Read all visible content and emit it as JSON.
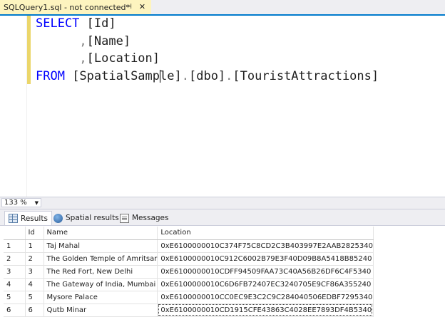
{
  "document_tab": {
    "title": "SQLQuery1.sql - not connected*",
    "pin_icon": "pin-icon",
    "close_icon": "close-icon",
    "background": "#fdf4bf"
  },
  "editor": {
    "lines": [
      [
        {
          "text": "SELECT ",
          "cls": "kw"
        },
        {
          "text": "[Id]",
          "cls": "ident"
        }
      ],
      [
        {
          "text": "      ,",
          "cls": "gray"
        },
        {
          "text": "[Name]",
          "cls": "ident"
        }
      ],
      [
        {
          "text": "      ,",
          "cls": "gray"
        },
        {
          "text": "[Location]",
          "cls": "ident"
        }
      ],
      [
        {
          "text": "FROM ",
          "cls": "kw"
        },
        {
          "text": "[SpatialSamp",
          "cls": "ident"
        },
        {
          "caret": true
        },
        {
          "text": "le]",
          "cls": "ident"
        },
        {
          "text": ".",
          "cls": "gray"
        },
        {
          "text": "[dbo]",
          "cls": "ident"
        },
        {
          "text": ".",
          "cls": "gray"
        },
        {
          "text": "[TouristAttractions]",
          "cls": "ident"
        }
      ]
    ],
    "keyword_color": "#0000ff"
  },
  "zoom": {
    "value": "133 %"
  },
  "results_tabs": [
    {
      "label": "Results",
      "icon": "grid-icon",
      "active": true
    },
    {
      "label": "Spatial results",
      "icon": "globe-icon",
      "active": false
    },
    {
      "label": "Messages",
      "icon": "messages-icon",
      "active": false
    }
  ],
  "results": {
    "columns": [
      "",
      "Id",
      "Name",
      "Location"
    ],
    "rows": [
      [
        "1",
        "1",
        "Taj Mahal",
        "0xE6100000010C374F75C8CD2C3B403997E2AAB2825340"
      ],
      [
        "2",
        "2",
        "The Golden Temple of Amritsar",
        "0xE6100000010C912C6002B79E3F40D09B8A5418B85240"
      ],
      [
        "3",
        "3",
        "The Red Fort, New Delhi",
        "0xE6100000010CDFF94509FAA73C40A56B26DF6C4F5340"
      ],
      [
        "4",
        "4",
        "The Gateway of India, Mumbai",
        "0xE6100000010C6D6FB72407EC3240705E9CF86A355240"
      ],
      [
        "5",
        "5",
        "Mysore Palace",
        "0xE6100000010CC0EC9E3C2C9C284040506EDBF7295340"
      ],
      [
        "6",
        "6",
        "Qutb Minar",
        "0xE6100000010CD1915CFE43863C4028EE7893DF4B5340"
      ]
    ],
    "selected_cell": {
      "row": 5,
      "col": 3
    }
  }
}
